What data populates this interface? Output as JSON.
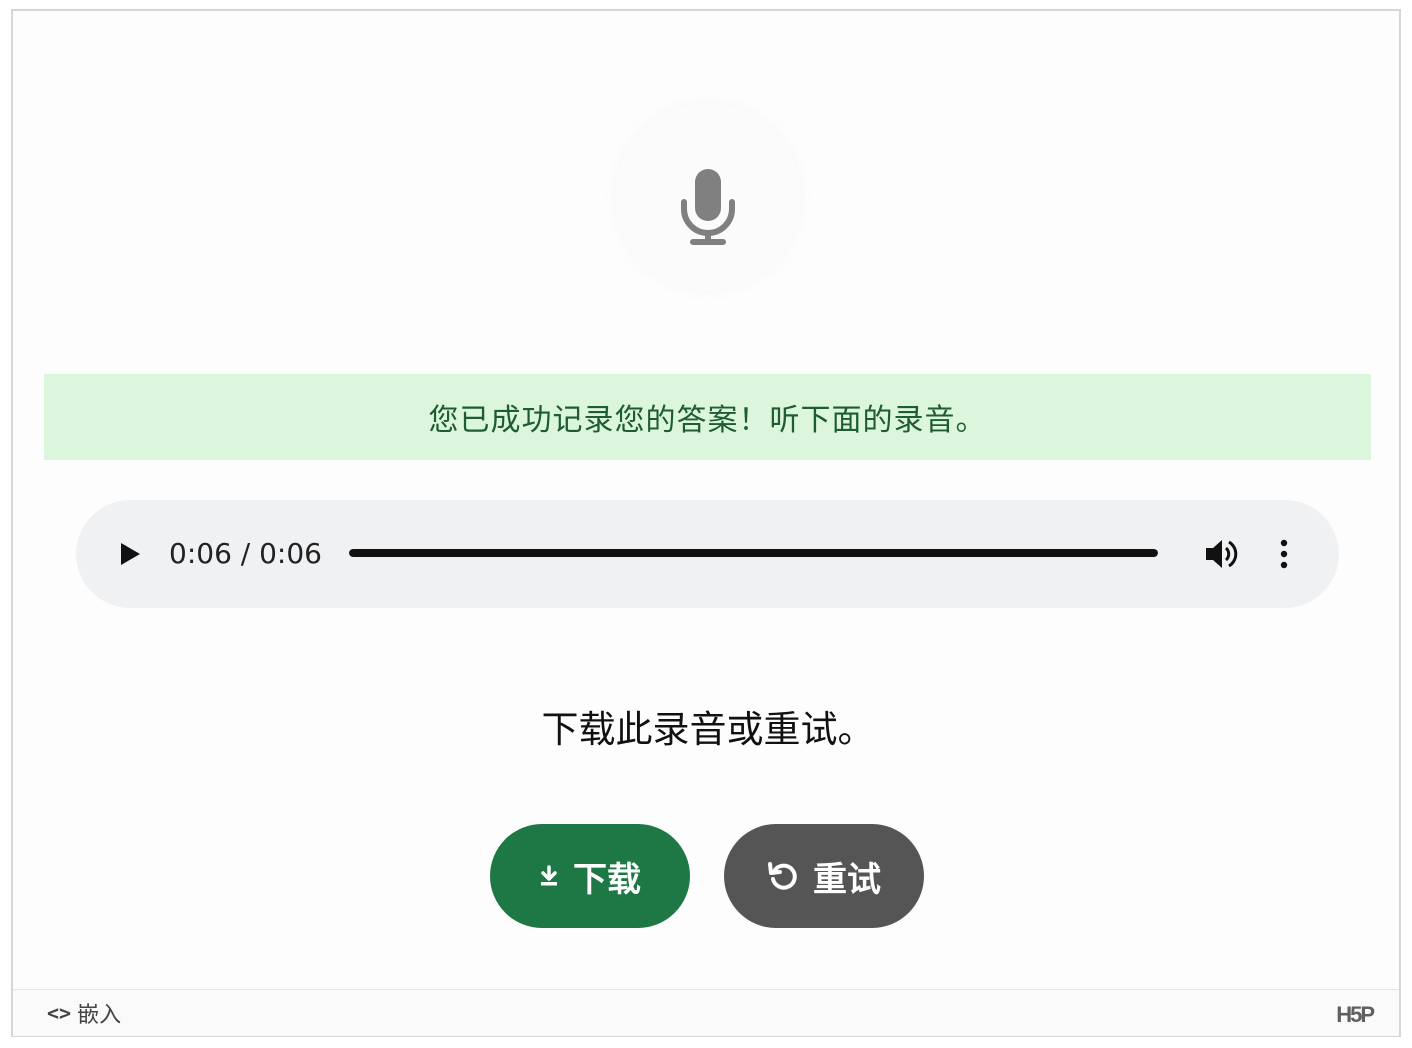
{
  "recorder": {
    "mic_icon": "microphone-icon",
    "status_message": "您已成功记录您的答案！听下面的录音。",
    "colors": {
      "banner_bg": "#dbf6dd",
      "banner_text": "#1f5c33",
      "download_bg": "#1d7846",
      "retry_bg": "#555555"
    }
  },
  "audio": {
    "time_display": "0:06 / 0:06",
    "progress_fraction": 1.0,
    "play_icon": "play-icon",
    "volume_icon": "volume-icon",
    "more_icon": "more-vertical-icon"
  },
  "prompt": "下载此录音或重试。",
  "buttons": {
    "download_label": "下载",
    "download_icon": "download-icon",
    "retry_label": "重试",
    "retry_icon": "retry-icon"
  },
  "footer": {
    "embed_icon": "<>",
    "embed_label": "嵌入",
    "logo": "H5P"
  }
}
